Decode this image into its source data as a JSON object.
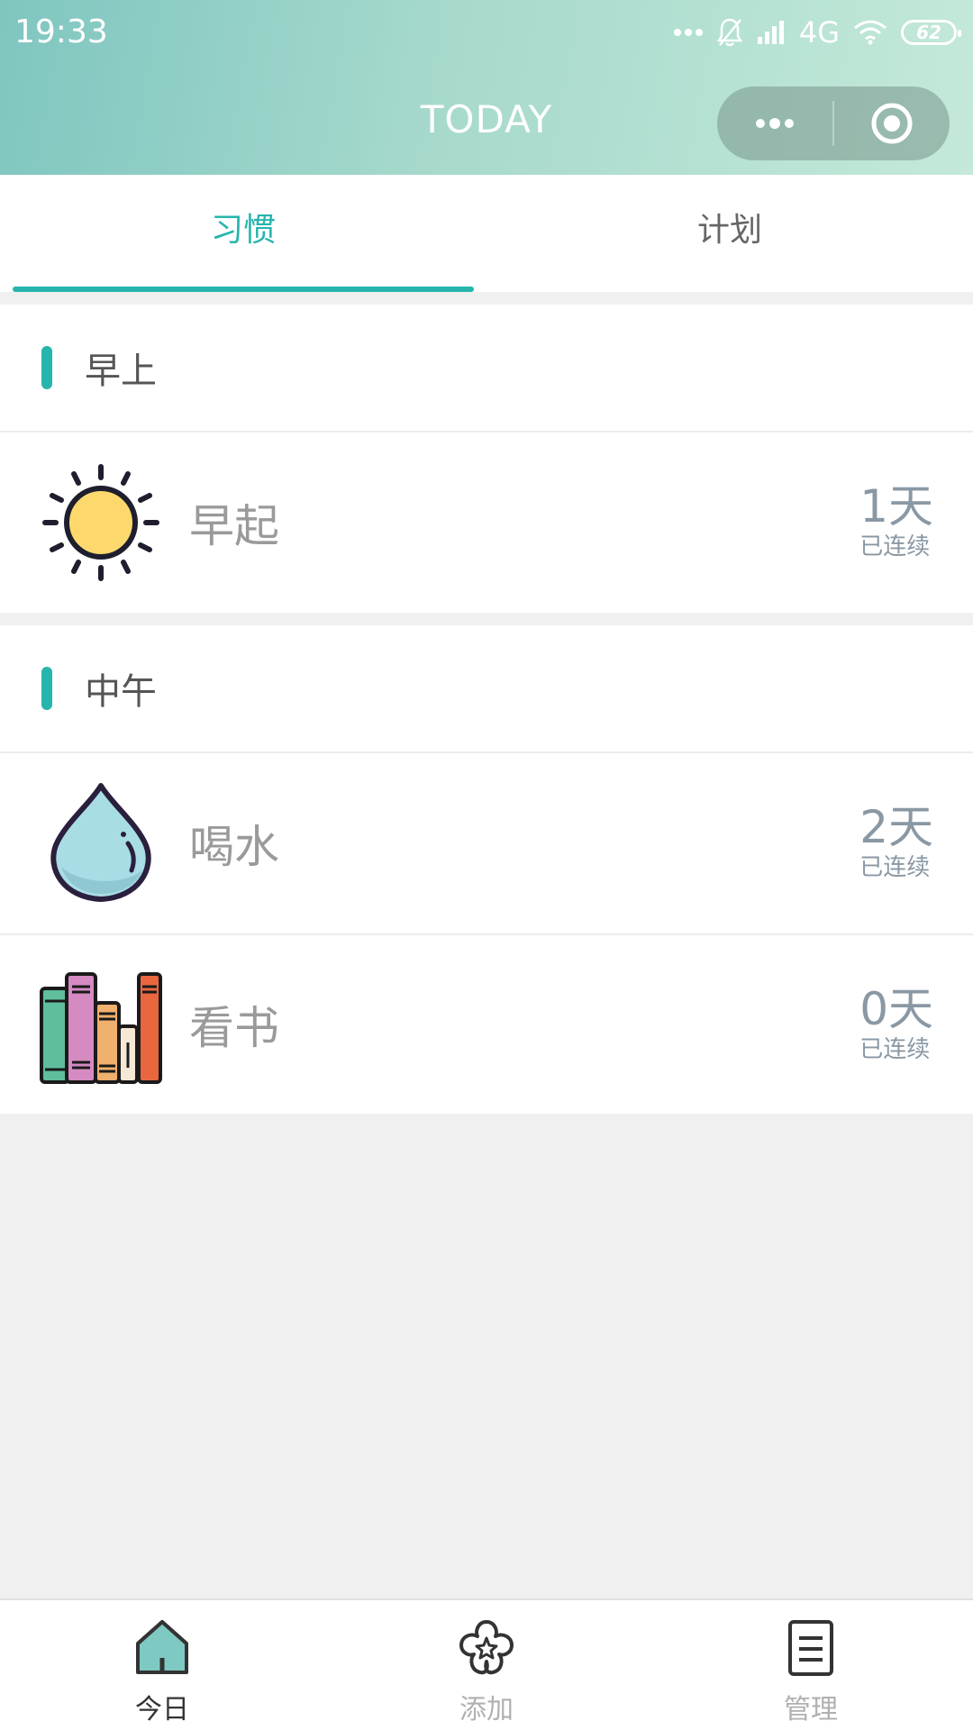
{
  "status_bar": {
    "time": "19:33",
    "network": "4G",
    "battery": "62"
  },
  "nav": {
    "title": "TODAY",
    "more_icon": "more-dots-icon",
    "close_icon": "target-circle-icon"
  },
  "tabs": [
    {
      "label": "习惯",
      "active": true
    },
    {
      "label": "计划",
      "active": false
    }
  ],
  "sections": [
    {
      "title": "早上",
      "habits": [
        {
          "name": "早起",
          "icon": "sun-icon",
          "streak_value": "1天",
          "streak_label": "已连续"
        }
      ]
    },
    {
      "title": "中午",
      "habits": [
        {
          "name": "喝水",
          "icon": "water-drop-icon",
          "streak_value": "2天",
          "streak_label": "已连续"
        },
        {
          "name": "看书",
          "icon": "books-icon",
          "streak_value": "0天",
          "streak_label": "已连续"
        }
      ]
    }
  ],
  "tabbar": [
    {
      "label": "今日",
      "icon": "home-icon",
      "active": true
    },
    {
      "label": "添加",
      "icon": "flower-icon",
      "active": false
    },
    {
      "label": "管理",
      "icon": "document-icon",
      "active": false
    }
  ],
  "colors": {
    "accent": "#26b5ad",
    "header_start": "#7fc6c0",
    "header_end": "#c4e9d9",
    "streak_text": "#8a98a4"
  }
}
